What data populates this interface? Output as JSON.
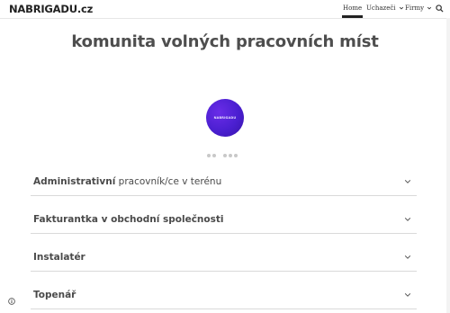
{
  "header": {
    "logo_text": "NABRIGADU.cz",
    "nav": [
      {
        "label": "Home",
        "active": true
      },
      {
        "label": "Uchazeči"
      },
      {
        "label": "Firmy"
      }
    ],
    "search_icon": "search-icon"
  },
  "hero": {
    "title": "komunita volných pracovních míst",
    "circle_text": "NABRIGADU",
    "accent_color": "#4a1fd0"
  },
  "carousel": {
    "dot_count": 5
  },
  "accordion": {
    "items": [
      {
        "label_bold": "Administrativní",
        "label_rest": " pracovník/ce v terénu"
      },
      {
        "label_bold": "Fakturantka v obchodní společnosti",
        "label_rest": ""
      },
      {
        "label_bold": "Instalatér",
        "label_rest": ""
      },
      {
        "label_bold": "Topenář",
        "label_rest": ""
      }
    ]
  }
}
